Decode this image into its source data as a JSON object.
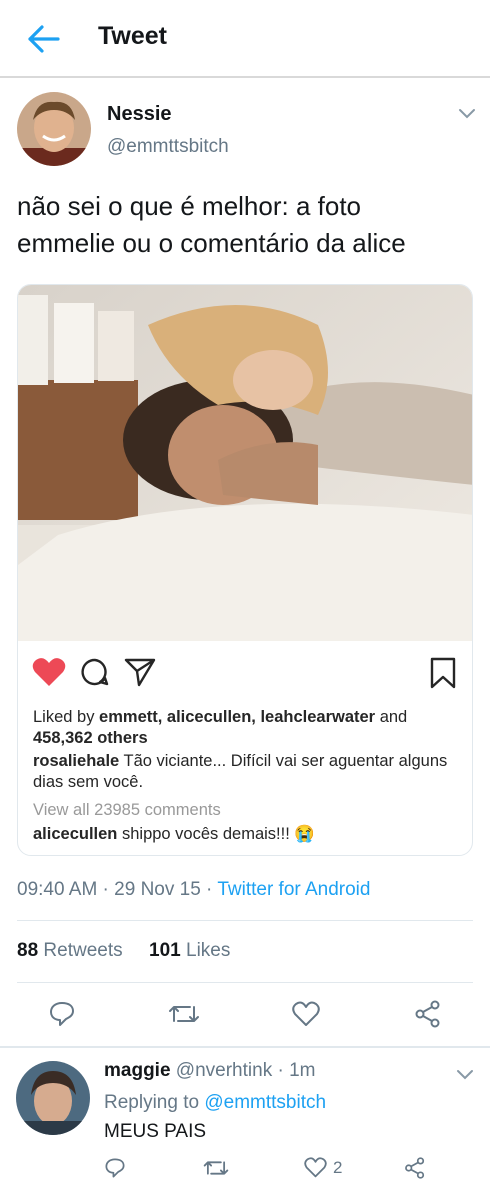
{
  "header": {
    "title": "Tweet"
  },
  "tweet": {
    "author_name": "Nessie",
    "author_handle": "@emmttsbitch",
    "text_line1": "não sei o que é melhor: a foto",
    "text_line2": "emmelie ou o comentário da alice",
    "timestamp": "09:40 AM · 29 Nov 15 · ",
    "source": "Twitter for Android",
    "retweets_count": "88",
    "retweets_label": " Retweets",
    "likes_count": "101",
    "likes_label": " Likes"
  },
  "instagram": {
    "liked_prefix": "Liked by ",
    "liked_users": "emmett, alicecullen, leahclearwater",
    "liked_and": " and",
    "liked_others": "458,362 others",
    "caption_user": "rosaliehale",
    "caption_text_line1": " Tão viciante... Difícil vai ser aguentar alguns",
    "caption_text_line2": "dias sem você.",
    "view_comments": "View all 23985 comments",
    "comment_user": "alicecullen",
    "comment_text": " shippo vocês demais!!! 😭"
  },
  "reply": {
    "author_name": "maggie",
    "author_handle": " @nverhtink · 1m",
    "replying_prefix": "Replying to ",
    "replying_handle": "@emmttsbitch",
    "text": "MEUS PAIS",
    "like_count": "2"
  },
  "colors": {
    "twitter_blue": "#1da1f2",
    "heart_red": "#ed4956",
    "muted_gray": "#657786"
  }
}
